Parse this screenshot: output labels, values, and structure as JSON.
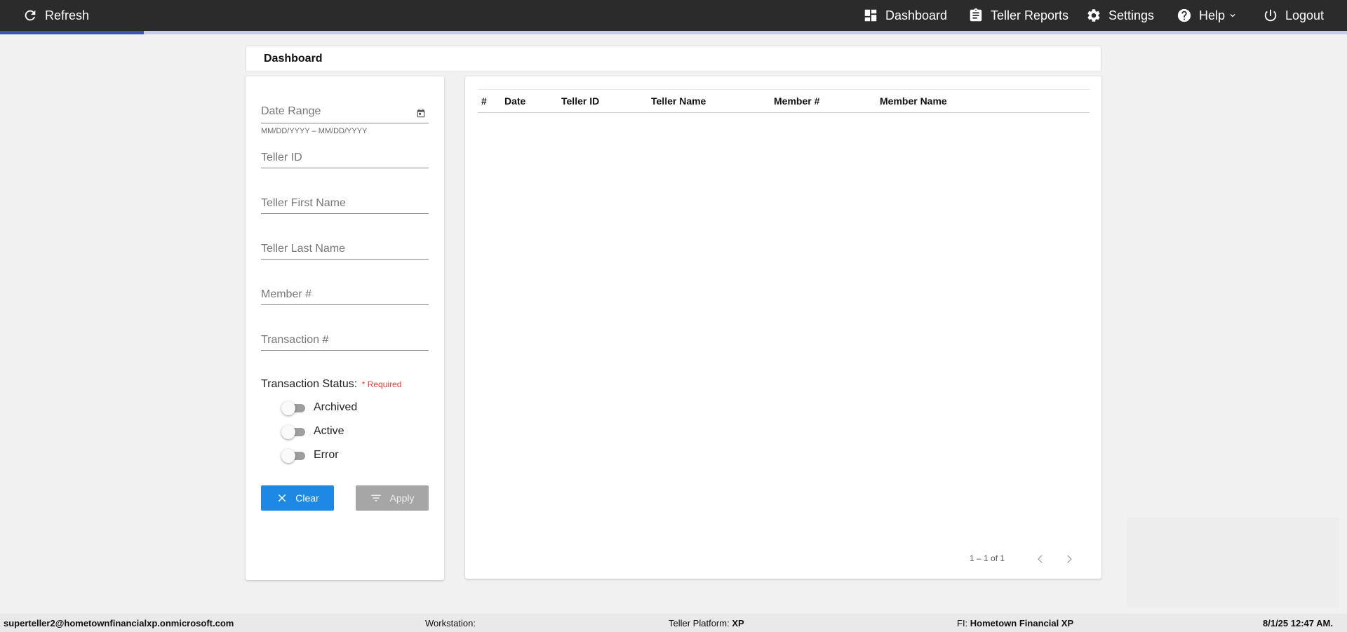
{
  "topbar": {
    "refresh_label": "Refresh",
    "dashboard_label": "Dashboard",
    "teller_reports_label": "Teller Reports",
    "settings_label": "Settings",
    "help_label": "Help",
    "logout_label": "Logout",
    "progress_fraction": 0.107,
    "colors": {
      "bar": "#2b2b2b",
      "progress": "#3f51b5"
    }
  },
  "page": {
    "title": "Dashboard"
  },
  "filters": {
    "date_range_label": "Date Range",
    "date_range_hint": "MM/DD/YYYY – MM/DD/YYYY",
    "teller_id_label": "Teller ID",
    "teller_first_name_label": "Teller First Name",
    "teller_last_name_label": "Teller Last Name",
    "member_number_label": "Member #",
    "transaction_number_label": "Transaction #",
    "transaction_status_label": "Transaction Status:",
    "required_label": "* Required",
    "toggles": [
      {
        "label": "Archived",
        "on": false
      },
      {
        "label": "Active",
        "on": false
      },
      {
        "label": "Error",
        "on": false
      }
    ],
    "clear_label": "Clear",
    "apply_label": "Apply"
  },
  "table": {
    "columns": [
      "#",
      "Date",
      "Teller ID",
      "Teller Name",
      "Member #",
      "Member Name"
    ],
    "rows": [],
    "pagination": "1 – 1 of 1"
  },
  "footer": {
    "user": "superteller2@hometownfinancialxp.onmicrosoft.com",
    "workstation_label": "Workstation:",
    "workstation_value": "",
    "platform_label": "Teller Platform:",
    "platform_value": "XP",
    "fi_label": "FI:",
    "fi_value": "Hometown Financial XP",
    "datetime": "8/1/25 12:47 AM."
  }
}
